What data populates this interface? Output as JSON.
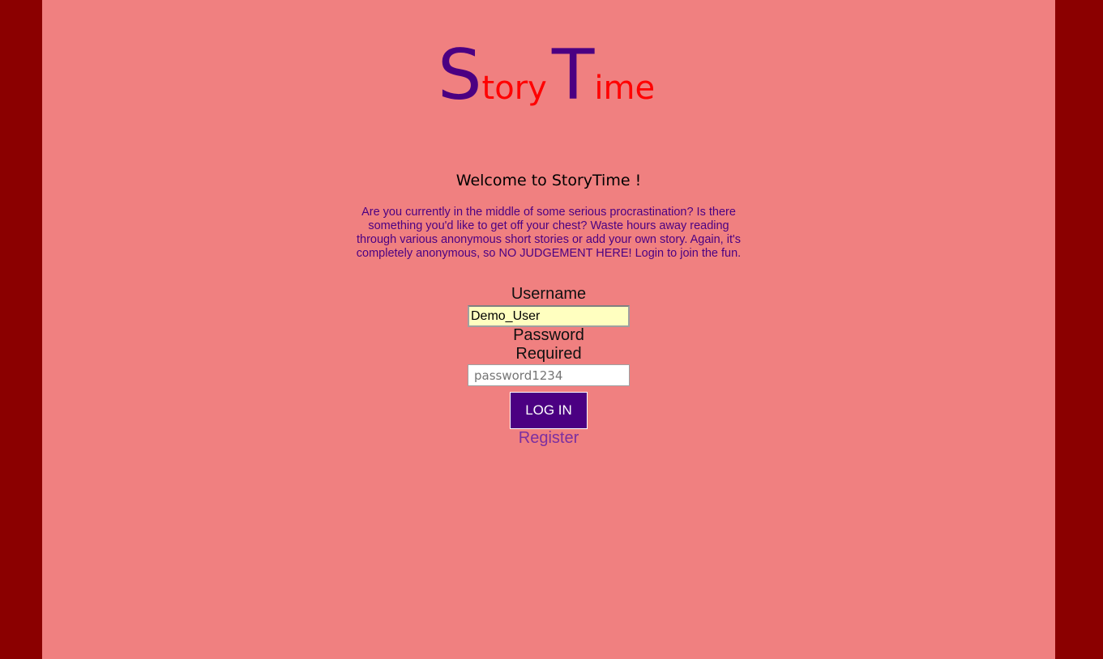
{
  "logo": {
    "s_big": "S",
    "s_rest": "tory",
    "t_big": "T",
    "t_rest": "ime"
  },
  "welcome": "Welcome to StoryTime !",
  "intro": "Are you currently in the middle of some serious procrastination? Is there something you'd like to get off your chest? Waste hours away reading through various anonymous short stories or add your own story. Again, it's completely anonymous, so NO JUDGEMENT HERE! Login to join the fun.",
  "form": {
    "username_label": "Username",
    "username_value": "Demo_User",
    "password_label": "Password",
    "password_required": "Required",
    "password_placeholder": "password1234",
    "login_button": "LOG IN",
    "register_link": "Register"
  },
  "colors": {
    "outer_background": "#8b0000",
    "page_background": "#f08080",
    "logo_big": "#4b0082",
    "logo_small": "#ff0000",
    "button": "#4b0082",
    "link": "#7b2fa0"
  }
}
